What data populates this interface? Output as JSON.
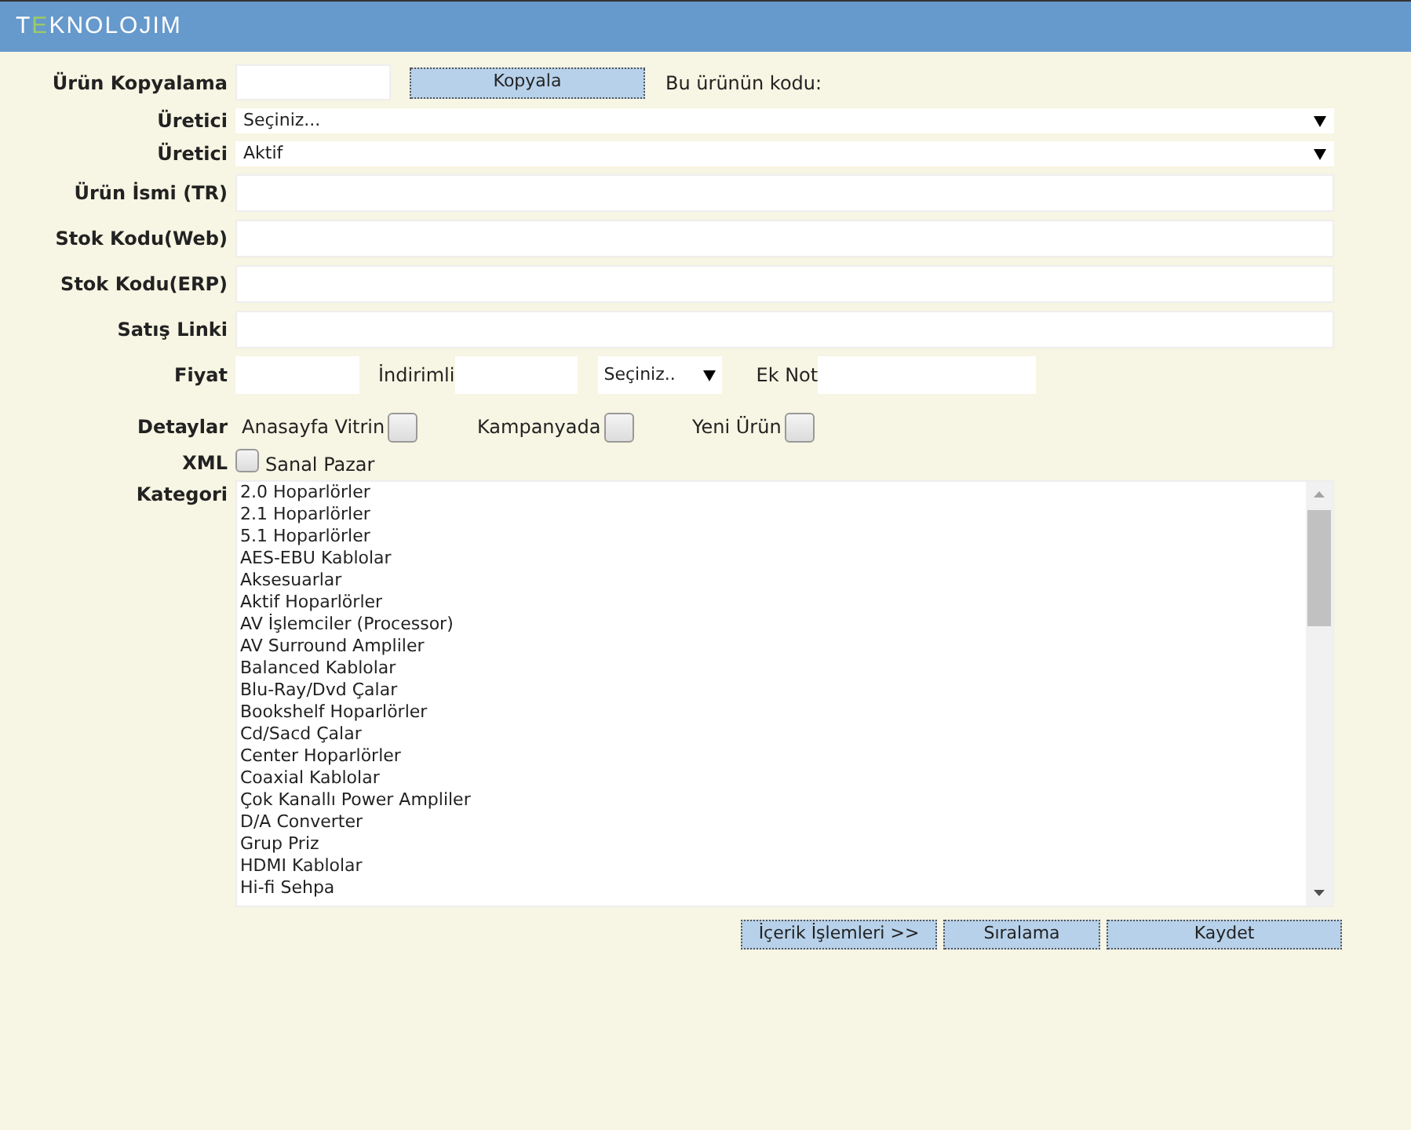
{
  "header": {
    "logo": [
      {
        "text": "T",
        "color": "#ffffff"
      },
      {
        "text": "E",
        "color": "#9ccc65"
      },
      {
        "text": "KNOLOJIM",
        "color": "#ffffff"
      }
    ]
  },
  "copy_row": {
    "label": "Ürün Kopyalama",
    "button": "Kopyala",
    "note": "Bu ürünün kodu:"
  },
  "selects": [
    {
      "label": "Üretici",
      "value": "Seçiniz..."
    },
    {
      "label": "Üretici",
      "value": "Aktif"
    }
  ],
  "text_fields": [
    {
      "label": "Ürün İsmi (TR)"
    },
    {
      "label": "Stok Kodu(Web)"
    },
    {
      "label": "Stok Kodu(ERP)"
    },
    {
      "label": "Satış Linki"
    }
  ],
  "price_row": {
    "label": "Fiyat",
    "discount_label": "İndirimli",
    "currency_select": "Seçiniz..",
    "note_label": "Ek Not"
  },
  "details": {
    "label": "Detaylar",
    "options": [
      {
        "label": "Anasayfa Vitrin",
        "checked": false
      },
      {
        "label": "Kampanyada",
        "checked": false
      },
      {
        "label": "Yeni Ürün",
        "checked": false
      }
    ]
  },
  "xml": {
    "label": "XML",
    "option": {
      "label": "Sanal Pazar",
      "checked": false
    }
  },
  "category": {
    "label": "Kategori",
    "items": [
      "2.0 Hoparlörler",
      "2.1 Hoparlörler",
      "5.1 Hoparlörler",
      "AES-EBU Kablolar",
      "Aksesuarlar",
      "Aktif Hoparlörler",
      "AV İşlemciler (Processor)",
      "AV Surround Ampliler",
      "Balanced Kablolar",
      "Blu-Ray/Dvd Çalar",
      "Bookshelf Hoparlörler",
      "Cd/Sacd Çalar",
      "Center Hoparlörler",
      "Coaxial Kablolar",
      "Çok Kanallı Power Ampliler",
      "D/A Converter",
      "Grup Priz",
      "HDMI Kablolar",
      "Hi-fi Sehpa"
    ]
  },
  "buttons": [
    "İçerik İşlemleri >>",
    "Sıralama",
    "Kaydet"
  ]
}
